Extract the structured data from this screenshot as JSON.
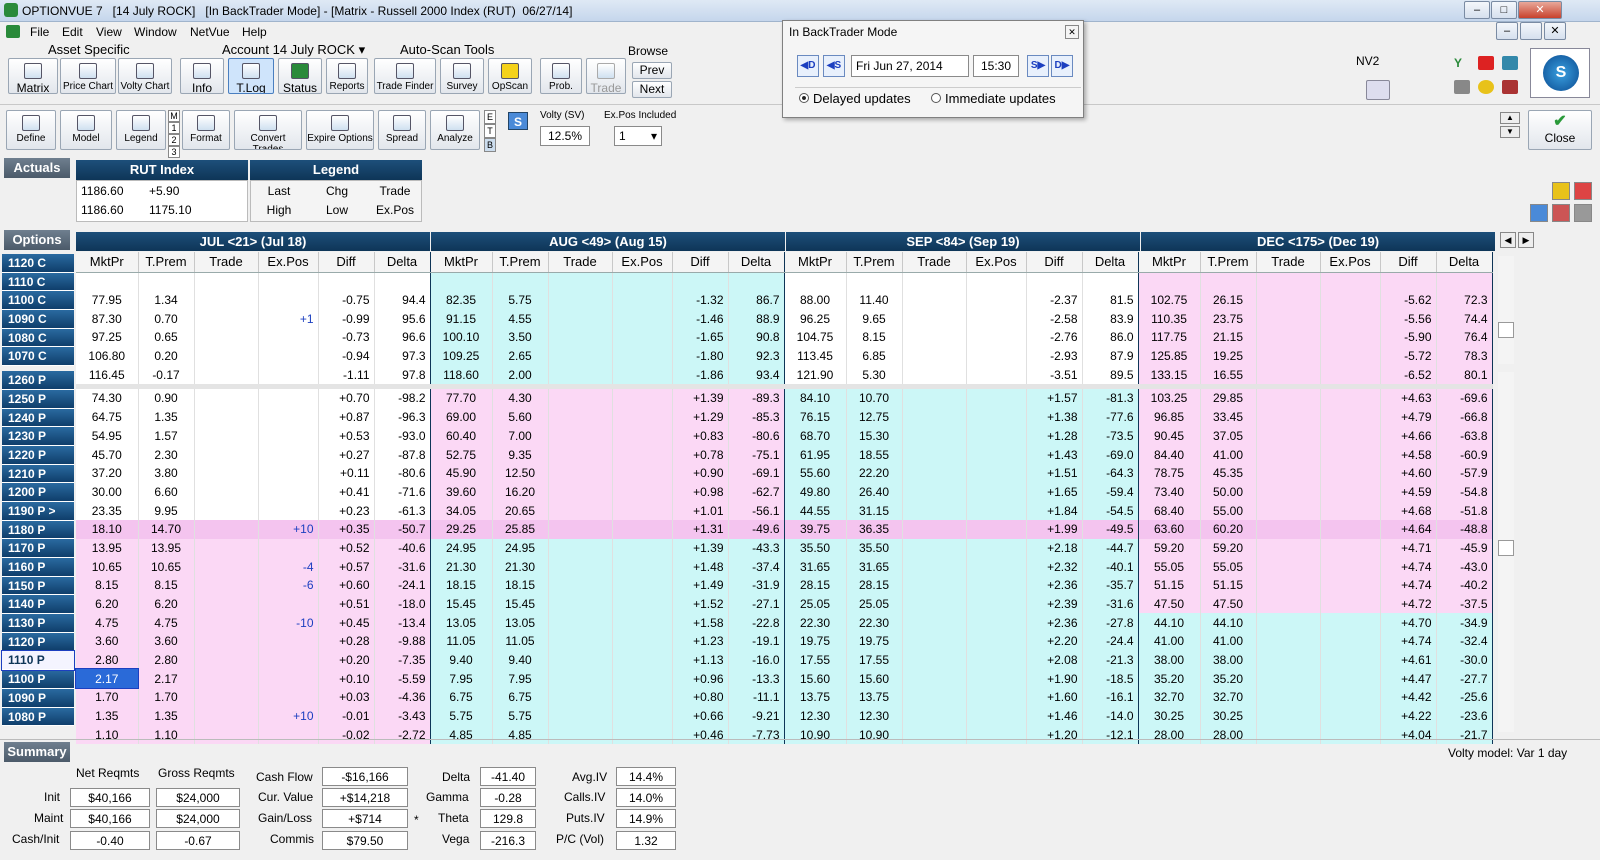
{
  "window": {
    "title": "OPTIONVUE 7   [14 July ROCK]   [In BackTrader Mode] - [Matrix - Russell 2000 Index (RUT)  06/27/14]",
    "min": "–",
    "max": "□",
    "close": "✕",
    "min2": "–",
    "restore": "❐",
    "close2": "✕"
  },
  "menu": [
    "File",
    "Edit",
    "View",
    "Window",
    "NetVue",
    "Help"
  ],
  "toolbar": {
    "asset_specific": "Asset Specific",
    "account": "Account 14 July ROCK",
    "autoscan": "Auto-Scan Tools",
    "browse": "Browse",
    "matrix": "Matrix",
    "price_chart": "Price Chart",
    "volty_chart": "Volty Chart",
    "info": "Info",
    "tlog": "T.Log",
    "status": "Status",
    "reports": "Reports",
    "trade_finder": "Trade Finder",
    "survey": "Survey",
    "opscan": "OpScan",
    "prob": "Prob.",
    "trade": "Trade",
    "prev": "Prev",
    "next": "Next",
    "nv2": "NV2",
    "define": "Define",
    "model": "Model",
    "legend": "Legend",
    "format": "Format",
    "convert_trades": "Convert Trades",
    "expire_options": "Expire Options",
    "spread": "Spread",
    "analyze": "Analyze",
    "close": "Close",
    "volty_label": "Volty (SV)",
    "volty_value": "12.5%",
    "expos_label": "Ex.Pos Included",
    "expos_value": "1",
    "s_btn": "S",
    "m123": [
      "M",
      "1",
      "2",
      "3"
    ],
    "etb": [
      "E",
      "T",
      "B"
    ]
  },
  "popup": {
    "title": "In BackTrader Mode",
    "date": "Fri Jun 27, 2014",
    "time": "15:30",
    "delayed": "Delayed updates",
    "immediate": "Immediate updates",
    "btn_d": "D",
    "btn_s": "S",
    "btn_s2": "S",
    "btn_d2": "D"
  },
  "actuals": {
    "label": "Actuals",
    "index": "RUT Index",
    "legend": "Legend",
    "last": "1186.60",
    "chg": "+5.90",
    "high": "1186.60",
    "low": "1175.10",
    "legend_cells": [
      "Last",
      "Chg",
      "Trade",
      "High",
      "Low",
      "Ex.Pos"
    ]
  },
  "options_label": "Options",
  "months": [
    "JUL <21> (Jul 18)",
    "AUG <49> (Aug 15)",
    "SEP <84> (Sep 19)",
    "DEC <175> (Dec 19)"
  ],
  "cols": [
    "MktPr",
    "T.Prem",
    "Trade",
    "Ex.Pos",
    "Diff",
    "Delta"
  ],
  "calls": [
    {
      "s": "1120 C",
      "d": [
        [
          "",
          "",
          "",
          "",
          "",
          ""
        ],
        [
          "",
          "",
          "",
          "",
          "",
          ""
        ],
        [
          "",
          "",
          "",
          "",
          "",
          ""
        ],
        [
          "",
          "",
          "",
          "",
          "",
          ""
        ]
      ]
    },
    {
      "s": "1110 C",
      "d": [
        [
          "77.95",
          "1.34",
          "",
          "",
          "-0.75",
          "94.4"
        ],
        [
          "82.35",
          "5.75",
          "",
          "",
          "-1.32",
          "86.7"
        ],
        [
          "88.00",
          "11.40",
          "",
          "",
          "-2.37",
          "81.5"
        ],
        [
          "102.75",
          "26.15",
          "",
          "",
          "-5.62",
          "72.3"
        ]
      ]
    },
    {
      "s": "1100 C",
      "d": [
        [
          "87.30",
          "0.70",
          "",
          "+1",
          "-0.99",
          "95.6"
        ],
        [
          "91.15",
          "4.55",
          "",
          "",
          "-1.46",
          "88.9"
        ],
        [
          "96.25",
          "9.65",
          "",
          "",
          "-2.58",
          "83.9"
        ],
        [
          "110.35",
          "23.75",
          "",
          "",
          "-5.56",
          "74.4"
        ]
      ]
    },
    {
      "s": "1090 C",
      "d": [
        [
          "97.25",
          "0.65",
          "",
          "",
          "-0.73",
          "96.6"
        ],
        [
          "100.10",
          "3.50",
          "",
          "",
          "-1.65",
          "90.8"
        ],
        [
          "104.75",
          "8.15",
          "",
          "",
          "-2.76",
          "86.0"
        ],
        [
          "117.75",
          "21.15",
          "",
          "",
          "-5.90",
          "76.4"
        ]
      ]
    },
    {
      "s": "1080 C",
      "d": [
        [
          "106.80",
          "0.20",
          "",
          "",
          "-0.94",
          "97.3"
        ],
        [
          "109.25",
          "2.65",
          "",
          "",
          "-1.80",
          "92.3"
        ],
        [
          "113.45",
          "6.85",
          "",
          "",
          "-2.93",
          "87.9"
        ],
        [
          "125.85",
          "19.25",
          "",
          "",
          "-5.72",
          "78.3"
        ]
      ]
    },
    {
      "s": "1070 C",
      "d": [
        [
          "116.45",
          "-0.17",
          "",
          "",
          "-1.11",
          "97.8"
        ],
        [
          "118.60",
          "2.00",
          "",
          "",
          "-1.86",
          "93.4"
        ],
        [
          "121.90",
          "5.30",
          "",
          "",
          "-3.51",
          "89.5"
        ],
        [
          "133.15",
          "16.55",
          "",
          "",
          "-6.52",
          "80.1"
        ]
      ]
    }
  ],
  "puts": [
    {
      "s": "1260 P",
      "d": [
        [
          "74.30",
          "0.90",
          "",
          "",
          "+0.70",
          "-98.2"
        ],
        [
          "77.70",
          "4.30",
          "",
          "",
          "+1.39",
          "-89.3"
        ],
        [
          "84.10",
          "10.70",
          "",
          "",
          "+1.57",
          "-81.3"
        ],
        [
          "103.25",
          "29.85",
          "",
          "",
          "+4.63",
          "-69.6"
        ]
      ]
    },
    {
      "s": "1250 P",
      "d": [
        [
          "64.75",
          "1.35",
          "",
          "",
          "+0.87",
          "-96.3"
        ],
        [
          "69.00",
          "5.60",
          "",
          "",
          "+1.29",
          "-85.3"
        ],
        [
          "76.15",
          "12.75",
          "",
          "",
          "+1.38",
          "-77.6"
        ],
        [
          "96.85",
          "33.45",
          "",
          "",
          "+4.79",
          "-66.8"
        ]
      ]
    },
    {
      "s": "1240 P",
      "d": [
        [
          "54.95",
          "1.57",
          "",
          "",
          "+0.53",
          "-93.0"
        ],
        [
          "60.40",
          "7.00",
          "",
          "",
          "+0.83",
          "-80.6"
        ],
        [
          "68.70",
          "15.30",
          "",
          "",
          "+1.28",
          "-73.5"
        ],
        [
          "90.45",
          "37.05",
          "",
          "",
          "+4.66",
          "-63.8"
        ]
      ]
    },
    {
      "s": "1230 P",
      "d": [
        [
          "45.70",
          "2.30",
          "",
          "",
          "+0.27",
          "-87.8"
        ],
        [
          "52.75",
          "9.35",
          "",
          "",
          "+0.78",
          "-75.1"
        ],
        [
          "61.95",
          "18.55",
          "",
          "",
          "+1.43",
          "-69.0"
        ],
        [
          "84.40",
          "41.00",
          "",
          "",
          "+4.58",
          "-60.9"
        ]
      ]
    },
    {
      "s": "1220 P",
      "d": [
        [
          "37.20",
          "3.80",
          "",
          "",
          "+0.11",
          "-80.6"
        ],
        [
          "45.90",
          "12.50",
          "",
          "",
          "+0.90",
          "-69.1"
        ],
        [
          "55.60",
          "22.20",
          "",
          "",
          "+1.51",
          "-64.3"
        ],
        [
          "78.75",
          "45.35",
          "",
          "",
          "+4.60",
          "-57.9"
        ]
      ]
    },
    {
      "s": "1210 P",
      "d": [
        [
          "30.00",
          "6.60",
          "",
          "",
          "+0.41",
          "-71.6"
        ],
        [
          "39.60",
          "16.20",
          "",
          "",
          "+0.98",
          "-62.7"
        ],
        [
          "49.80",
          "26.40",
          "",
          "",
          "+1.65",
          "-59.4"
        ],
        [
          "73.40",
          "50.00",
          "",
          "",
          "+4.59",
          "-54.8"
        ]
      ]
    },
    {
      "s": "1200 P",
      "d": [
        [
          "23.35",
          "9.95",
          "",
          "",
          "+0.23",
          "-61.3"
        ],
        [
          "34.05",
          "20.65",
          "",
          "",
          "+1.01",
          "-56.1"
        ],
        [
          "44.55",
          "31.15",
          "",
          "",
          "+1.84",
          "-54.5"
        ],
        [
          "68.40",
          "55.00",
          "",
          "",
          "+4.68",
          "-51.8"
        ]
      ]
    },
    {
      "s": "1190 P >",
      "d": [
        [
          "18.10",
          "14.70",
          "",
          "+10",
          "+0.35",
          "-50.7"
        ],
        [
          "29.25",
          "25.85",
          "",
          "",
          "+1.31",
          "-49.6"
        ],
        [
          "39.75",
          "36.35",
          "",
          "",
          "+1.99",
          "-49.5"
        ],
        [
          "63.60",
          "60.20",
          "",
          "",
          "+4.64",
          "-48.8"
        ]
      ]
    },
    {
      "s": "1180 P",
      "d": [
        [
          "13.95",
          "13.95",
          "",
          "",
          "+0.52",
          "-40.6"
        ],
        [
          "24.95",
          "24.95",
          "",
          "",
          "+1.39",
          "-43.3"
        ],
        [
          "35.50",
          "35.50",
          "",
          "",
          "+2.18",
          "-44.7"
        ],
        [
          "59.20",
          "59.20",
          "",
          "",
          "+4.71",
          "-45.9"
        ]
      ]
    },
    {
      "s": "1170 P",
      "d": [
        [
          "10.65",
          "10.65",
          "",
          "-4",
          "+0.57",
          "-31.6"
        ],
        [
          "21.30",
          "21.30",
          "",
          "",
          "+1.48",
          "-37.4"
        ],
        [
          "31.65",
          "31.65",
          "",
          "",
          "+2.32",
          "-40.1"
        ],
        [
          "55.05",
          "55.05",
          "",
          "",
          "+4.74",
          "-43.0"
        ]
      ]
    },
    {
      "s": "1160 P",
      "d": [
        [
          "8.15",
          "8.15",
          "",
          "-6",
          "+0.60",
          "-24.1"
        ],
        [
          "18.15",
          "18.15",
          "",
          "",
          "+1.49",
          "-31.9"
        ],
        [
          "28.15",
          "28.15",
          "",
          "",
          "+2.36",
          "-35.7"
        ],
        [
          "51.15",
          "51.15",
          "",
          "",
          "+4.74",
          "-40.2"
        ]
      ]
    },
    {
      "s": "1150 P",
      "d": [
        [
          "6.20",
          "6.20",
          "",
          "",
          "+0.51",
          "-18.0"
        ],
        [
          "15.45",
          "15.45",
          "",
          "",
          "+1.52",
          "-27.1"
        ],
        [
          "25.05",
          "25.05",
          "",
          "",
          "+2.39",
          "-31.6"
        ],
        [
          "47.50",
          "47.50",
          "",
          "",
          "+4.72",
          "-37.5"
        ]
      ]
    },
    {
      "s": "1140 P",
      "d": [
        [
          "4.75",
          "4.75",
          "",
          "-10",
          "+0.45",
          "-13.4"
        ],
        [
          "13.05",
          "13.05",
          "",
          "",
          "+1.58",
          "-22.8"
        ],
        [
          "22.30",
          "22.30",
          "",
          "",
          "+2.36",
          "-27.8"
        ],
        [
          "44.10",
          "44.10",
          "",
          "",
          "+4.70",
          "-34.9"
        ]
      ]
    },
    {
      "s": "1130 P",
      "d": [
        [
          "3.60",
          "3.60",
          "",
          "",
          "+0.28",
          "-9.88"
        ],
        [
          "11.05",
          "11.05",
          "",
          "",
          "+1.23",
          "-19.1"
        ],
        [
          "19.75",
          "19.75",
          "",
          "",
          "+2.20",
          "-24.4"
        ],
        [
          "41.00",
          "41.00",
          "",
          "",
          "+4.74",
          "-32.4"
        ]
      ]
    },
    {
      "s": "1120 P",
      "d": [
        [
          "2.80",
          "2.80",
          "",
          "",
          "+0.20",
          "-7.35"
        ],
        [
          "9.40",
          "9.40",
          "",
          "",
          "+1.13",
          "-16.0"
        ],
        [
          "17.55",
          "17.55",
          "",
          "",
          "+2.08",
          "-21.3"
        ],
        [
          "38.00",
          "38.00",
          "",
          "",
          "+4.61",
          "-30.0"
        ]
      ]
    },
    {
      "s": "1110 P",
      "d": [
        [
          "2.17",
          "2.17",
          "",
          "",
          "+0.10",
          "-5.59"
        ],
        [
          "7.95",
          "7.95",
          "",
          "",
          "+0.96",
          "-13.3"
        ],
        [
          "15.60",
          "15.60",
          "",
          "",
          "+1.90",
          "-18.5"
        ],
        [
          "35.20",
          "35.20",
          "",
          "",
          "+4.47",
          "-27.7"
        ]
      ]
    },
    {
      "s": "1100 P",
      "d": [
        [
          "1.70",
          "1.70",
          "",
          "",
          "+0.03",
          "-4.36"
        ],
        [
          "6.75",
          "6.75",
          "",
          "",
          "+0.80",
          "-11.1"
        ],
        [
          "13.75",
          "13.75",
          "",
          "",
          "+1.60",
          "-16.1"
        ],
        [
          "32.70",
          "32.70",
          "",
          "",
          "+4.42",
          "-25.6"
        ]
      ]
    },
    {
      "s": "1090 P",
      "d": [
        [
          "1.35",
          "1.35",
          "",
          "+10",
          "-0.01",
          "-3.43"
        ],
        [
          "5.75",
          "5.75",
          "",
          "",
          "+0.66",
          "-9.21"
        ],
        [
          "12.30",
          "12.30",
          "",
          "",
          "+1.46",
          "-14.0"
        ],
        [
          "30.25",
          "30.25",
          "",
          "",
          "+4.22",
          "-23.6"
        ]
      ]
    },
    {
      "s": "1080 P",
      "d": [
        [
          "1.10",
          "1.10",
          "",
          "",
          "-0.02",
          "-2.72"
        ],
        [
          "4.85",
          "4.85",
          "",
          "",
          "+0.46",
          "-7.73"
        ],
        [
          "10.90",
          "10.90",
          "",
          "",
          "+1.20",
          "-12.1"
        ],
        [
          "28.00",
          "28.00",
          "",
          "",
          "+4.04",
          "-21.7"
        ]
      ]
    }
  ],
  "summary": {
    "label": "Summary",
    "volty_model": "Volty model: Var 1 day",
    "net_reqmts": "Net Reqmts",
    "gross_reqmts": "Gross Reqmts",
    "init": "Init",
    "maint": "Maint",
    "cash_init": "Cash/Init",
    "init_net": "$40,166",
    "init_gross": "$24,000",
    "maint_net": "$40,166",
    "maint_gross": "$24,000",
    "ci_net": "-0.40",
    "ci_gross": "-0.67",
    "cash_flow": "Cash Flow",
    "cur_value": "Cur. Value",
    "gain_loss": "Gain/Loss",
    "commis": "Commis",
    "cash_flow_v": "-$16,166",
    "cur_value_v": "+$14,218",
    "gain_loss_v": "+$714",
    "commis_v": "$79.50",
    "star": "*",
    "delta": "Delta",
    "gamma": "Gamma",
    "theta": "Theta",
    "vega": "Vega",
    "delta_v": "-41.40",
    "gamma_v": "-0.28",
    "theta_v": "129.8",
    "vega_v": "-216.3",
    "avgiv": "Avg.IV",
    "callsiv": "Calls.IV",
    "putsiv": "Puts.IV",
    "pcvol": "P/C (Vol)",
    "avgiv_v": "14.4%",
    "callsiv_v": "14.0%",
    "putsiv_v": "14.9%",
    "pcvol_v": "1.32"
  },
  "colors": {
    "call": "#ccf7f7",
    "put": "#fbd8f5",
    "header": "#0e3557",
    "strike": "#1a5a90"
  }
}
